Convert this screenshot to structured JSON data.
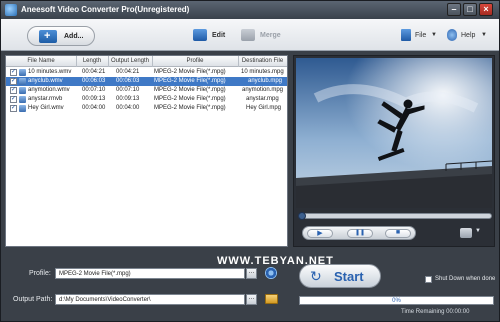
{
  "window": {
    "title": "Aneesoft Video Converter Pro(Unregistered)",
    "min_glyph": "–",
    "max_glyph": "□",
    "close_glyph": "×"
  },
  "toolbar": {
    "add_label": "Add...",
    "edit_label": "Edit",
    "merge_label": "Merge",
    "file_label": "File",
    "help_label": "Help",
    "arrow_glyph": "▼"
  },
  "file_list": {
    "columns": [
      "File Name",
      "Length",
      "Output Length",
      "Profile",
      "Destination File"
    ],
    "rows": [
      {
        "file_name": "10 minutes.wmv",
        "length": "00:04:21",
        "output_length": "00:04:21",
        "profile": "MPEG-2 Movie File(*.mpg)",
        "destination": "10 minutes.mpg",
        "selected": false
      },
      {
        "file_name": "anyclub.wmv",
        "length": "00:06:03",
        "output_length": "00:06:03",
        "profile": "MPEG-2 Movie File(*.mpg)",
        "destination": "anyclub.mpg",
        "selected": true
      },
      {
        "file_name": "anymotion.wmv",
        "length": "00:07:10",
        "output_length": "00:07:10",
        "profile": "MPEG-2 Movie File(*.mpg)",
        "destination": "anymotion.mpg",
        "selected": false
      },
      {
        "file_name": "anystar.rmvb",
        "length": "00:09:13",
        "output_length": "00:09:13",
        "profile": "MPEG-2 Movie File(*.mpg)",
        "destination": "anystar.mpg",
        "selected": false
      },
      {
        "file_name": "Hey Girl.wmv",
        "length": "00:04:00",
        "output_length": "00:04:00",
        "profile": "MPEG-2 Movie File(*.mpg)",
        "destination": "Hey Girl.mpg",
        "selected": false
      }
    ]
  },
  "player": {
    "play_glyph": "▶",
    "pause_glyph": "❚❚",
    "stop_glyph": "■",
    "seek_fraction": 0.0
  },
  "watermark": "WWW.TEBYAN.NET",
  "output": {
    "profile_label": "Profile:",
    "profile_value": "MPEG-2 Movie File(*.mpg)",
    "path_label": "Output Path:",
    "path_value": "d:\\My Documents\\VideoConverter\\",
    "browse_glyph": "..."
  },
  "convert": {
    "start_label": "Start",
    "start_glyph": "↻",
    "shutdown_label": "Shut Down when done",
    "progress_percent": 0,
    "progress_text": "0%",
    "time_remaining": "Time Remaining 00:00:00"
  },
  "colors": {
    "accent": "#2a62b0",
    "selection": "#3f79c6"
  }
}
